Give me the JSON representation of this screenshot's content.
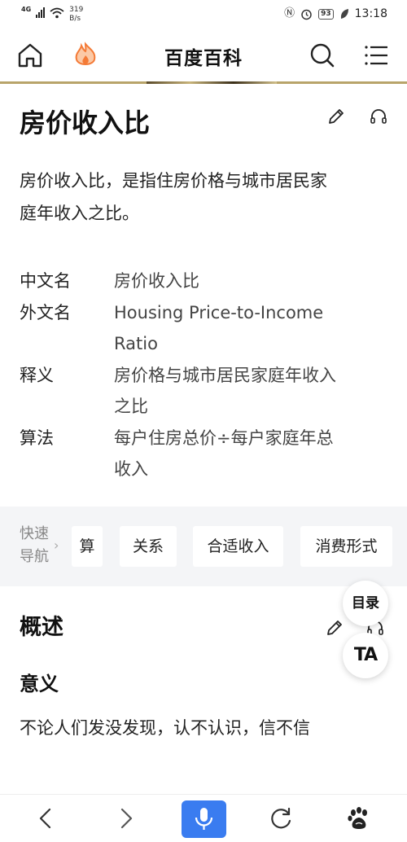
{
  "status_bar": {
    "network": "4G",
    "speed_value": "319",
    "speed_unit": "B/s",
    "battery": "93",
    "time": "13:18"
  },
  "header": {
    "title": "百度百科",
    "icons": [
      "home-icon",
      "fire-icon",
      "search-icon",
      "menu-icon"
    ]
  },
  "entry": {
    "title": "房价收入比",
    "summary_lines": [
      "房价收入比，是指住房价格与城市居民家",
      "庭年收入之比。"
    ],
    "info": [
      {
        "key": "中文名",
        "value_lines": [
          "房价收入比"
        ]
      },
      {
        "key": "外文名",
        "value_lines": [
          "Housing Price-to-Income",
          "Ratio"
        ]
      },
      {
        "key": "释义",
        "value_lines": [
          "房价格与城市居民家庭年收入",
          "之比"
        ]
      },
      {
        "key": "算法",
        "value_lines": [
          "每户住房总价÷每户家庭年总",
          "收入"
        ]
      }
    ]
  },
  "quick_nav": {
    "label_lines": [
      "快速",
      "导航"
    ],
    "chevron": "›",
    "chips": [
      "算",
      "关系",
      "合适收入",
      "消费形式"
    ]
  },
  "section": {
    "title": "概述",
    "subtitle": "意义",
    "text": "不论人们发没发现，认不认识，信不信"
  },
  "floating": {
    "toc_label": "目录",
    "text_size_label": "TA"
  },
  "bottom_bar": {
    "icons": [
      "back-icon",
      "forward-icon",
      "mic-icon",
      "refresh-icon",
      "baidu-paw-icon"
    ]
  },
  "colors": {
    "accent_blue": "#3a7cf0",
    "fire_orange": "#f47a36",
    "quicknav_bg": "#f4f5f7"
  }
}
